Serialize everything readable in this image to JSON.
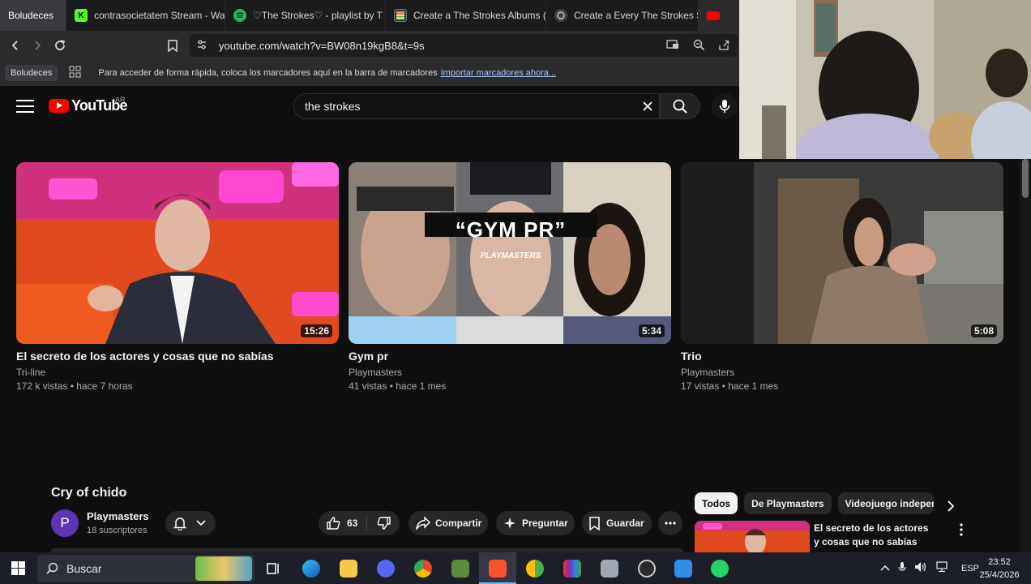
{
  "browser": {
    "tabs": [
      {
        "label": "Boludeces",
        "icon": "tab-group-label"
      },
      {
        "label": "contrasocietatem Stream - Wat",
        "icon": "kick-icon"
      },
      {
        "label": "♡The Strokes♡ - playlist by T",
        "icon": "spotify-icon"
      },
      {
        "label": "Create a The Strokes Albums (i",
        "icon": "tiermaker-icon"
      },
      {
        "label": "Create a Every The Strokes Son",
        "icon": "tiermaker-icon"
      }
    ],
    "url": "youtube.com/watch?v=BW08n19kgB8&t=9s",
    "bookmarks": {
      "chip": "Boludeces",
      "hint": "Para acceder de forma rápida, coloca los marcadores aquí en la barra de marcadores",
      "import_link": "Importar marcadores ahora..."
    }
  },
  "youtube": {
    "logo_text": "YouTube",
    "country": "AR",
    "search_value": "the strokes"
  },
  "videos": [
    {
      "title": "El secreto de los actores y cosas que no sabías",
      "channel": "Tri-line",
      "meta": "172 k vistas • hace 7 horas",
      "duration": "15:26"
    },
    {
      "title": "Gym pr",
      "channel": "Playmasters",
      "meta": "41 vistas • hace 1 mes",
      "duration": "5:34",
      "overlay_title": "“GYM PR”",
      "overlay_sub": "PLAYMASTERS"
    },
    {
      "title": "Trio",
      "channel": "Playmasters",
      "meta": "17 vistas • hace 1 mes",
      "duration": "5:08"
    }
  ],
  "watch": {
    "title": "Cry of chido",
    "channel_initial": "P",
    "channel": "Playmasters",
    "subscribers": "18 suscriptores",
    "likes": "63",
    "share": "Compartir",
    "ask": "Preguntar",
    "save": "Guardar"
  },
  "sidebar": {
    "chips": [
      "Todos",
      "De Playmasters",
      "Videojuego independ"
    ],
    "first_video_title": "El secreto de los actores y cosas que no sabías"
  },
  "taskbar": {
    "search_label": "Buscar",
    "language": "ESP",
    "time": "23:52",
    "date": "25/4/2026"
  }
}
